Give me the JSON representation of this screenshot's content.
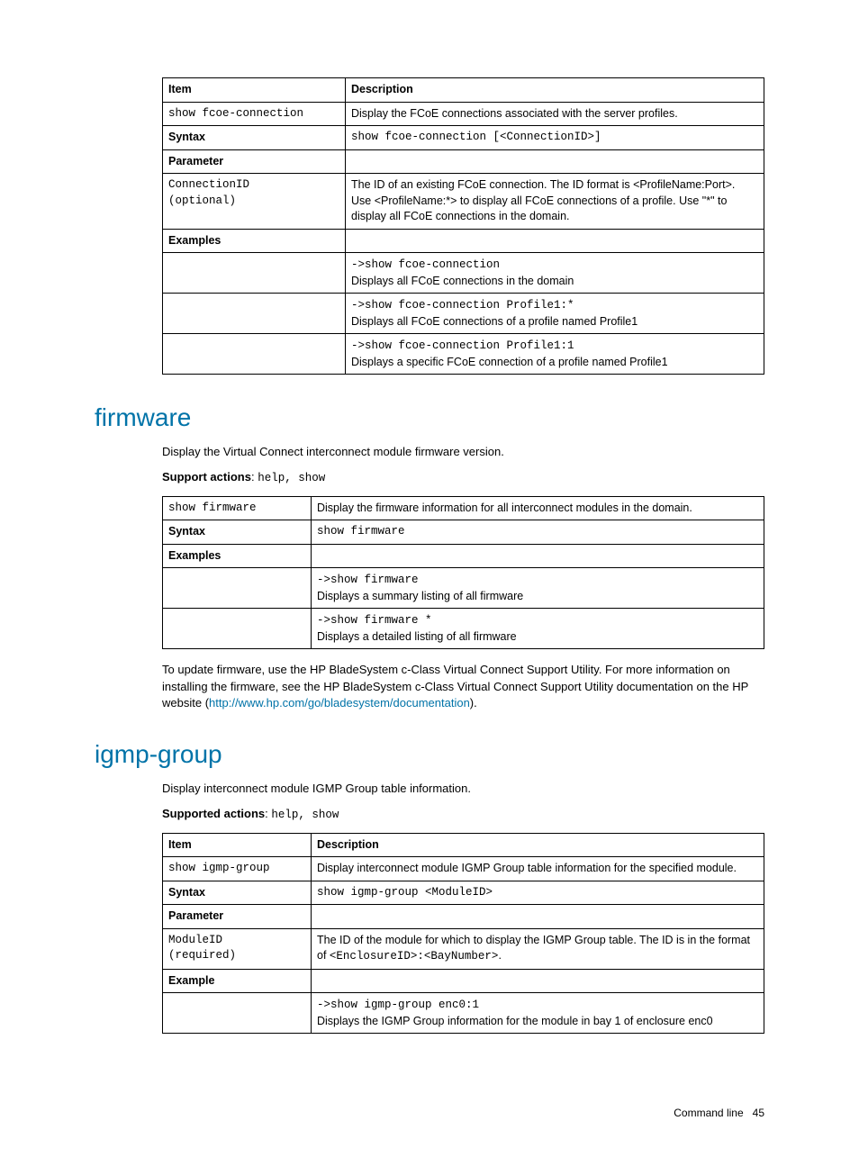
{
  "table1": {
    "h1": "Item",
    "h2": "Description",
    "r1c1": "show fcoe-connection",
    "r1c2": "Display the FCoE connections associated with the server profiles.",
    "r2c1": "Syntax",
    "r2c2": "show fcoe-connection [<ConnectionID>]",
    "r3c1": "Parameter",
    "r4c1a": "ConnectionID",
    "r4c1b": "(optional)",
    "r4c2": "The ID of an existing FCoE connection. The ID format is <ProfileName:Port>. Use <ProfileName:*> to display all FCoE connections of a profile. Use \"*\" to display all FCoE connections in the domain.",
    "r5c1": "Examples",
    "r6a": "->show fcoe-connection",
    "r6b": "Displays all FCoE connections in the domain",
    "r7a": "->show fcoe-connection Profile1:*",
    "r7b": "Displays all FCoE connections of a profile named Profile1",
    "r8a": "->show fcoe-connection Profile1:1",
    "r8b": "Displays a specific FCoE connection of a profile named Profile1"
  },
  "firmware": {
    "heading": "firmware",
    "intro": "Display the Virtual Connect interconnect module firmware version.",
    "support_label": "Support actions",
    "support_vals": "help, show",
    "t": {
      "r1c1": "show firmware",
      "r1c2": "Display the firmware information for all interconnect modules in the domain.",
      "r2c1": "Syntax",
      "r2c2": "show firmware",
      "r3c1": "Examples",
      "r4a": "->show firmware",
      "r4b": "Displays a summary listing of all firmware",
      "r5a": "->show firmware *",
      "r5b": "Displays a detailed listing of all firmware"
    },
    "note_pre": "To update firmware, use the HP BladeSystem c-Class Virtual Connect Support Utility. For more information on installing the firmware, see the HP BladeSystem c-Class Virtual Connect Support Utility documentation on the HP website (",
    "note_link": "http://www.hp.com/go/bladesystem/documentation",
    "note_post": ")."
  },
  "igmp": {
    "heading": "igmp-group",
    "intro": "Display interconnect module IGMP Group table information.",
    "support_label": "Supported actions",
    "support_vals": "help, show",
    "t": {
      "h1": "Item",
      "h2": "Description",
      "r1c1": "show igmp-group",
      "r1c2": "Display interconnect module IGMP Group table information for the specified module.",
      "r2c1": "Syntax",
      "r2c2": "show igmp-group <ModuleID>",
      "r3c1": "Parameter",
      "r4c1a": "ModuleID",
      "r4c1b": "(required)",
      "r4c2a": "The ID of the module for which to display the IGMP Group table. The ID is in the format of ",
      "r4c2b": "<EnclosureID>:<BayNumber>",
      "r4c2c": ".",
      "r5c1": "Example",
      "r6a": "->show igmp-group enc0:1",
      "r6b": "Displays the IGMP Group information for the module in bay 1 of enclosure enc0"
    }
  },
  "footer": {
    "label": "Command line",
    "page": "45"
  }
}
